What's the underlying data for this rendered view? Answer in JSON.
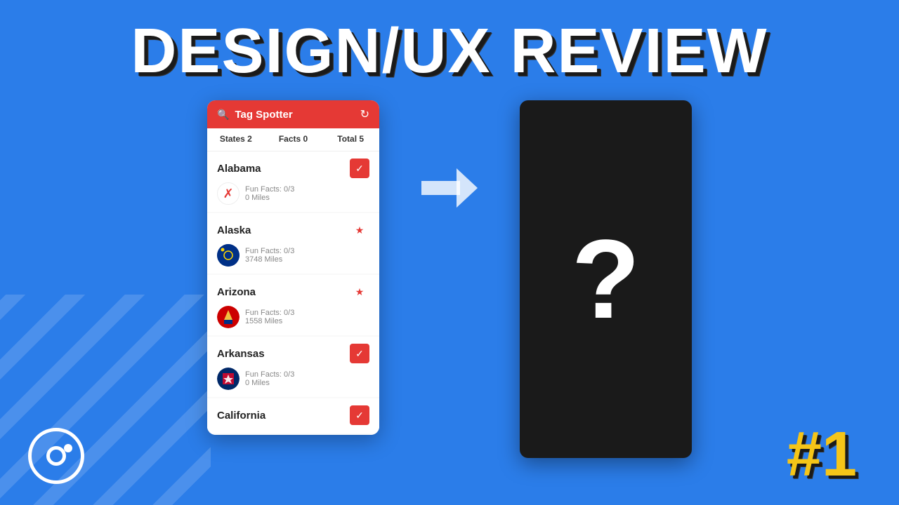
{
  "title": "DESIGN/UX REVIEW",
  "header": {
    "app_name": "Tag Spotter",
    "refresh_icon": "↻"
  },
  "tabs": [
    {
      "label": "States 2",
      "active": false
    },
    {
      "label": "Facts 0",
      "active": false
    },
    {
      "label": "Total 5",
      "active": false
    }
  ],
  "states": [
    {
      "name": "Alabama",
      "fun_facts": "Fun Facts: 0/3",
      "miles": "0 Miles",
      "starred": true,
      "error": true
    },
    {
      "name": "Alaska",
      "fun_facts": "Fun Facts: 0/3",
      "miles": "3748 Miles",
      "starred": true,
      "error": false
    },
    {
      "name": "Arizona",
      "fun_facts": "Fun Facts: 0/3",
      "miles": "1558 Miles",
      "starred": true,
      "error": false
    },
    {
      "name": "Arkansas",
      "fun_facts": "Fun Facts: 0/3",
      "miles": "0 Miles",
      "starred": true,
      "error": false
    },
    {
      "name": "California",
      "fun_facts": "",
      "miles": "",
      "starred": true,
      "error": false
    }
  ],
  "mystery_label": "?",
  "number_badge": "#1",
  "ionic_logo_alt": "Ionic Logo"
}
